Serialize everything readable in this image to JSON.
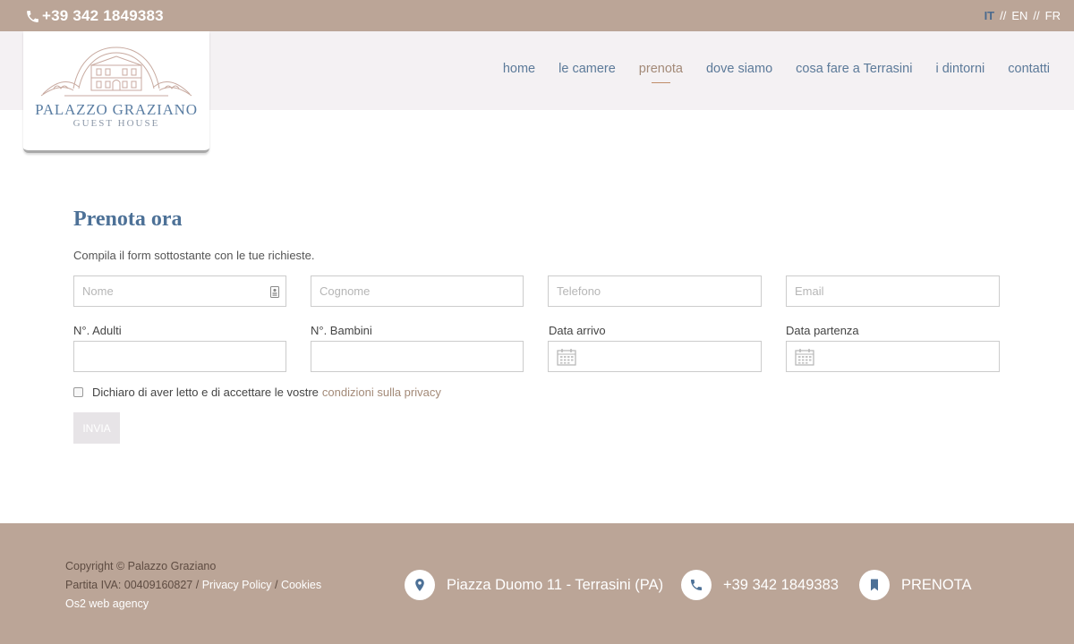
{
  "topbar": {
    "phone": "+39 342 1849383",
    "languages": [
      {
        "code": "IT",
        "active": true
      },
      {
        "code": "EN",
        "active": false
      },
      {
        "code": "FR",
        "active": false
      }
    ],
    "separator": "//"
  },
  "logo": {
    "title": "PALAZZO GRAZIANO",
    "subtitle": "GUEST HOUSE"
  },
  "menu": {
    "items": [
      "home",
      "le camere",
      "prenota",
      "dove siamo",
      "cosa fare a Terrasini",
      "i dintorni",
      "contatti"
    ],
    "current": "prenota"
  },
  "form": {
    "title": "Prenota ora",
    "intro": "Compila il form sottostante con le tue richieste.",
    "placeholders": {
      "nome": "Nome",
      "cognome": "Cognome",
      "telefono": "Telefono",
      "email": "Email"
    },
    "labels": {
      "adulti": "N°. Adulti",
      "bambini": "N°. Bambini",
      "arrivo": "Data arrivo",
      "partenza": "Data partenza"
    },
    "privacy_text": "Dichiaro di aver letto e di accettare le vostre",
    "privacy_link": "condizioni sulla privacy",
    "submit": "INVIA"
  },
  "footer": {
    "copyright": "Copyright © Palazzo Graziano",
    "vat": "Partita IVA: 00409160827",
    "slash": "/",
    "privacy_policy": "Privacy Policy",
    "cookies": "Cookies",
    "agency": "Os2 web agency",
    "address": "Piazza Duomo 11 - Terrasini (PA)",
    "phone": "+39 342 1849383",
    "book": "PRENOTA"
  },
  "colors": {
    "brand_bar": "#bba597",
    "nav_bg": "#f4f1f3",
    "accent_blue": "#4d7197",
    "accent_brown": "#a38a78"
  }
}
